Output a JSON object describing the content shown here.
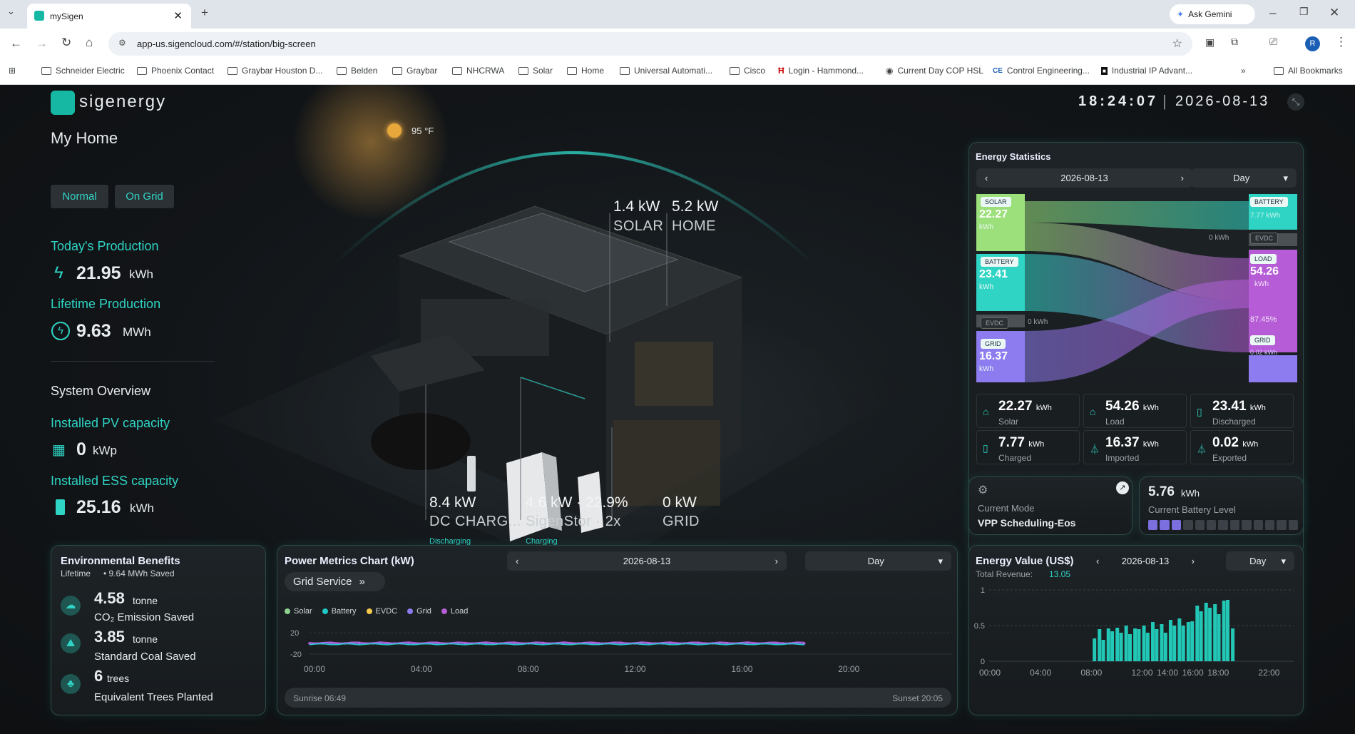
{
  "browser": {
    "tab_title": "mySigen",
    "url": "app-us.sigencloud.com/#/station/big-screen",
    "gemini": "Ask Gemini",
    "profile": "R",
    "bookmarks": [
      "Schneider Electric",
      "Phoenix Contact",
      "Graybar Houston D...",
      "Belden",
      "Graybar",
      "NHCRWA",
      "Solar",
      "Home",
      "Universal Automati...",
      "Cisco",
      "Login - Hammond...",
      "Current Day COP HSL",
      "Control Engineering...",
      "Industrial IP Advant..."
    ],
    "all_bookmarks": "All Bookmarks"
  },
  "header": {
    "logo": "sigenergy",
    "time": "18:24:07",
    "separator": "|",
    "date": "2026-08-13",
    "weather": "95 °F"
  },
  "left": {
    "home_title": "My Home",
    "badges": [
      "Normal",
      "On Grid"
    ],
    "today_prod_label": "Today's Production",
    "today_prod_value": "21.95",
    "today_prod_unit": "kWh",
    "lifetime_label": "Lifetime Production",
    "lifetime_value": "9.63",
    "lifetime_unit": "MWh",
    "overview_title": "System Overview",
    "pv_label": "Installed PV capacity",
    "pv_value": "0",
    "pv_unit": "kWp",
    "ess_label": "Installed ESS capacity",
    "ess_value": "25.16",
    "ess_unit": "kWh"
  },
  "house": {
    "solar_kw": "1.4 kW",
    "solar_label": "SOLAR",
    "home_kw": "5.2 kW",
    "home_label": "HOME",
    "dc_kw": "8.4 kW",
    "dc_label": "DC CHARG...",
    "dc_status": "Discharging",
    "stor_kw": "4.6 kW · 22.9%",
    "stor_label": "SigenStor · 2x",
    "stor_status": "Charging",
    "grid_kw": "0 kW",
    "grid_label": "GRID"
  },
  "energy_stats": {
    "title": "Energy Statistics",
    "date": "2026-08-13",
    "period": "Day",
    "sankey": {
      "left": [
        {
          "tag": "SOLAR",
          "value": "22.27",
          "unit": "kWh"
        },
        {
          "tag": "BATTERY",
          "value": "23.41",
          "unit": "kWh"
        },
        {
          "tag": "EVDC",
          "value": "0 kWh"
        },
        {
          "tag": "GRID",
          "value": "16.37",
          "unit": "kWh"
        }
      ],
      "right": [
        {
          "tag": "BATTERY",
          "value": "7.77 kWh"
        },
        {
          "tag": "EVDC",
          "value": "0 kWh"
        },
        {
          "tag": "LOAD",
          "value": "54.26",
          "unit": "kWh",
          "pct": "87.45%"
        },
        {
          "tag": "GRID",
          "value": "0.02 kWh"
        }
      ]
    },
    "cells": [
      {
        "value": "22.27",
        "unit": "kWh",
        "label": "Solar",
        "icon": "solar-home-icon"
      },
      {
        "value": "54.26",
        "unit": "kWh",
        "label": "Load",
        "icon": "home-icon"
      },
      {
        "value": "23.41",
        "unit": "kWh",
        "label": "Discharged",
        "icon": "battery-icon"
      },
      {
        "value": "7.77",
        "unit": "kWh",
        "label": "Charged",
        "icon": "battery-icon"
      },
      {
        "value": "16.37",
        "unit": "kWh",
        "label": "Imported",
        "icon": "tower-icon"
      },
      {
        "value": "0.02",
        "unit": "kWh",
        "label": "Exported",
        "icon": "tower-icon"
      }
    ]
  },
  "mode": {
    "label": "Current Mode",
    "value": "VPP Scheduling-Eos"
  },
  "battery": {
    "value": "5.76",
    "unit": "kWh",
    "label": "Current Battery Level",
    "level_segments_filled": 3,
    "level_segments_total": 13
  },
  "env": {
    "title": "Environmental Benefits",
    "lifetime": "Lifetime",
    "saved": "• 9.64 MWh Saved",
    "items": [
      {
        "value": "4.58",
        "unit": "tonne",
        "label": "CO₂ Emission Saved"
      },
      {
        "value": "3.85",
        "unit": "tonne",
        "label": "Standard Coal Saved"
      },
      {
        "value": "6",
        "unit": "trees",
        "label": "Equivalent Trees Planted"
      }
    ]
  },
  "power_chart": {
    "title": "Power Metrics Chart (kW)",
    "date": "2026-08-13",
    "period": "Day",
    "grid_service": "Grid Service",
    "legend": [
      {
        "name": "Solar",
        "color": "#8fd18f"
      },
      {
        "name": "Battery",
        "color": "#22c7c7"
      },
      {
        "name": "EVDC",
        "color": "#f2c94c"
      },
      {
        "name": "Grid",
        "color": "#8c7cf0"
      },
      {
        "name": "Load",
        "color": "#b65cd6"
      }
    ],
    "sunrise": "Sunrise 06:49",
    "sunset": "Sunset 20:05"
  },
  "value_chart": {
    "title": "Energy Value (US$)",
    "date": "2026-08-13",
    "period": "Day",
    "revenue_label": "Total Revenue:",
    "revenue_value": "13.05"
  },
  "chart_data": [
    {
      "type": "line",
      "title": "Power Metrics Chart (kW)",
      "x": [
        "00:00",
        "04:00",
        "08:00",
        "12:00",
        "16:00",
        "20:00"
      ],
      "ylim": [
        -20,
        20
      ],
      "yticks": [
        "20",
        "-20"
      ],
      "series": [
        {
          "name": "Load",
          "values": [
            0,
            0,
            0,
            0,
            0,
            0
          ]
        },
        {
          "name": "Grid",
          "values": [
            0,
            0,
            0,
            0,
            0,
            0
          ]
        },
        {
          "name": "Battery",
          "values": [
            0,
            0,
            0,
            0,
            0,
            0
          ]
        }
      ]
    },
    {
      "type": "bar",
      "title": "Energy Value (US$)",
      "ylim": [
        0,
        1
      ],
      "yticks": [
        "1",
        "0.5",
        "0"
      ],
      "xticks": [
        "00:00",
        "04:00",
        "08:00",
        "12:00",
        "14:00",
        "16:00",
        "18:00",
        "22:00"
      ],
      "x_hours": [
        8.3,
        8.7,
        9.0,
        9.4,
        9.7,
        10.1,
        10.4,
        10.8,
        11.1,
        11.5,
        11.8,
        12.2,
        12.5,
        12.9,
        13.2,
        13.6,
        13.9,
        14.3,
        14.6,
        15.0,
        15.3,
        15.7,
        16.0,
        16.4,
        16.7,
        17.1,
        17.4,
        17.8,
        18.1,
        18.5,
        18.8,
        19.2
      ],
      "values": [
        0.32,
        0.45,
        0.3,
        0.46,
        0.42,
        0.47,
        0.4,
        0.5,
        0.38,
        0.46,
        0.45,
        0.5,
        0.4,
        0.55,
        0.45,
        0.52,
        0.4,
        0.58,
        0.5,
        0.6,
        0.5,
        0.55,
        0.56,
        0.78,
        0.7,
        0.82,
        0.75,
        0.8,
        0.66,
        0.85,
        0.86,
        0.46
      ]
    }
  ]
}
